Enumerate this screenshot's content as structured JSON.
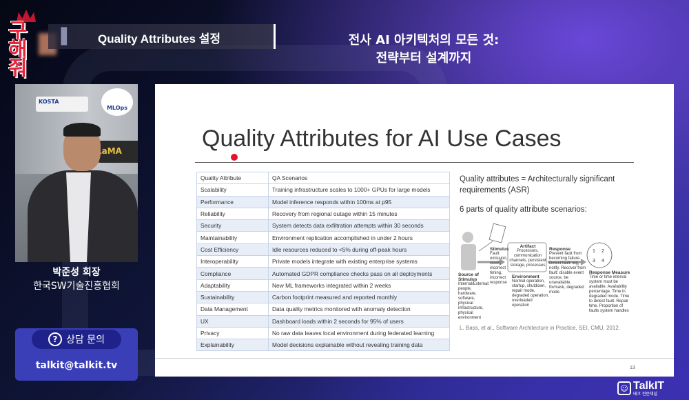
{
  "logo": {
    "text": "구해줘"
  },
  "banner": {
    "topic": "Quality Attributes 설정",
    "headline_line1": "전사 AI 아키텍처의 모든 것:",
    "headline_line2": "전략부터 설계까지"
  },
  "speaker": {
    "name": "박준성 회장",
    "org": "한국SW기술진흥협회",
    "sponsors": [
      "KOSTA",
      "MLOps",
      "LaMA"
    ]
  },
  "contact": {
    "label": "상담 문의",
    "email": "talkit@talkit.tv"
  },
  "slide": {
    "title": "Quality Attributes for AI Use Cases",
    "table_headers": [
      "Quality Attribute",
      "QA Scenarios"
    ],
    "rows": [
      [
        "Scalability",
        "Training infrastructure scales to 1000+ GPUs for large models"
      ],
      [
        "Performance",
        "Model inference responds within 100ms at p95"
      ],
      [
        "Reliability",
        "Recovery from regional outage within 15 minutes"
      ],
      [
        "Security",
        "System detects data exfiltration attempts within 30 seconds"
      ],
      [
        "Maintainability",
        "Environment replication accomplished in under 2 hours"
      ],
      [
        "Cost Efficiency",
        "Idle resources reduced to <5% during off-peak hours"
      ],
      [
        "Interoperability",
        "Private models integrate with existing enterprise systems"
      ],
      [
        "Compliance",
        "Automated GDPR compliance checks pass on all deployments"
      ],
      [
        "Adaptability",
        "New ML frameworks integrated within 2 weeks"
      ],
      [
        "Sustainability",
        "Carbon footprint measured and reported monthly"
      ],
      [
        "Data Management",
        "Data quality metrics monitored with anomaly detection"
      ],
      [
        "UX",
        "Dashboard loads within 2 seconds for 95% of users"
      ],
      [
        "Privacy",
        "No raw data leaves local environment during federated learning"
      ],
      [
        "Explainability",
        "Model decisions explainable without revealing training data"
      ]
    ],
    "right_text1": "Quality attributes = Architecturally significant requirements (ASR)",
    "right_text2": "6 parts of quality attribute scenarios:",
    "diagram": {
      "source_title": "Source of Stimulus",
      "source_desc": "Internal/External: people, hardware, software, physical infrastructure, physical environment",
      "stimulus_title": "Stimulus",
      "stimulus_desc": "Fault: omission, crash, incorrect timing, incorrect response",
      "artifact_title": "Artifact",
      "artifact_desc": "Processors, communication channels, persistent storage, processes",
      "environment_title": "Environment",
      "environment_desc": "Normal operation, startup, shutdown, repair mode, degraded operation, overloaded operation",
      "response_title": "Response",
      "response_desc": "Prevent fault from becoming failure. Detect fault: log, notify. Recover from fault: disable event source, be unavailable, fix/mask, degraded mode",
      "measure_title": "Response Measure",
      "measure_desc": "Time or time interval system must be available. Availability percentage. Time in degraded mode. Time to detect fault. Repair time. Proportion of faults system handles"
    },
    "citation": "L. Bass, et al., Software Architecture in Practice, SEI, CMU, 2012.",
    "page_number": "13"
  },
  "brand": {
    "name": "TalkIT",
    "sub": "테크 전문채널"
  }
}
